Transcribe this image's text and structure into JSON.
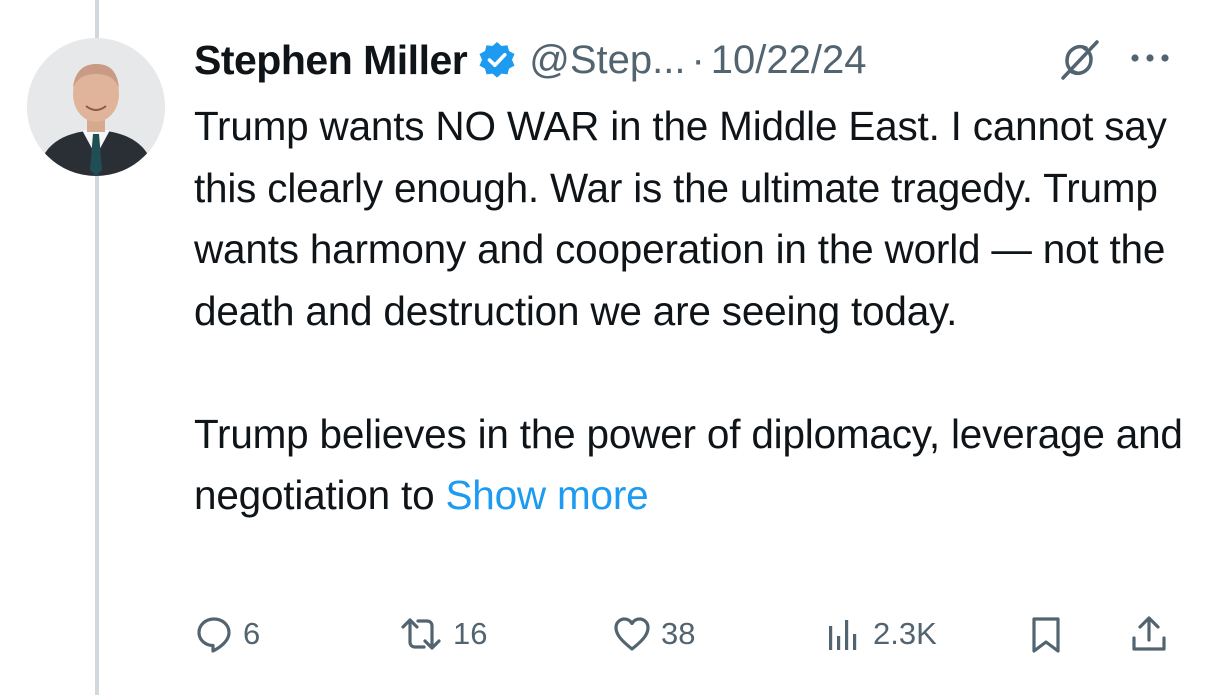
{
  "tweet": {
    "author_name": "Stephen Miller",
    "handle": "@Step...",
    "separator": "·",
    "date": "10/22/24",
    "paragraph1": "Trump wants NO WAR in the Middle East. I cannot say this clearly enough. War is the ultimate tragedy. Trump wants harmony and cooperation in the world — not the death and destruction we are seeing today.",
    "paragraph2_prefix": "Trump believes in the power of diplomacy, leverage and negotiation to ",
    "show_more": "Show more"
  },
  "actions": {
    "replies": "6",
    "reposts": "16",
    "likes": "38",
    "views": "2.3K"
  },
  "colors": {
    "accent": "#1d9bf0",
    "muted": "#536471",
    "text": "#0f1419",
    "thread_line": "#cfd9de"
  },
  "icons": [
    "verified-badge-icon",
    "grok-icon",
    "more-options-icon",
    "reply-icon",
    "repost-icon",
    "like-icon",
    "views-icon",
    "bookmark-icon",
    "share-icon"
  ]
}
